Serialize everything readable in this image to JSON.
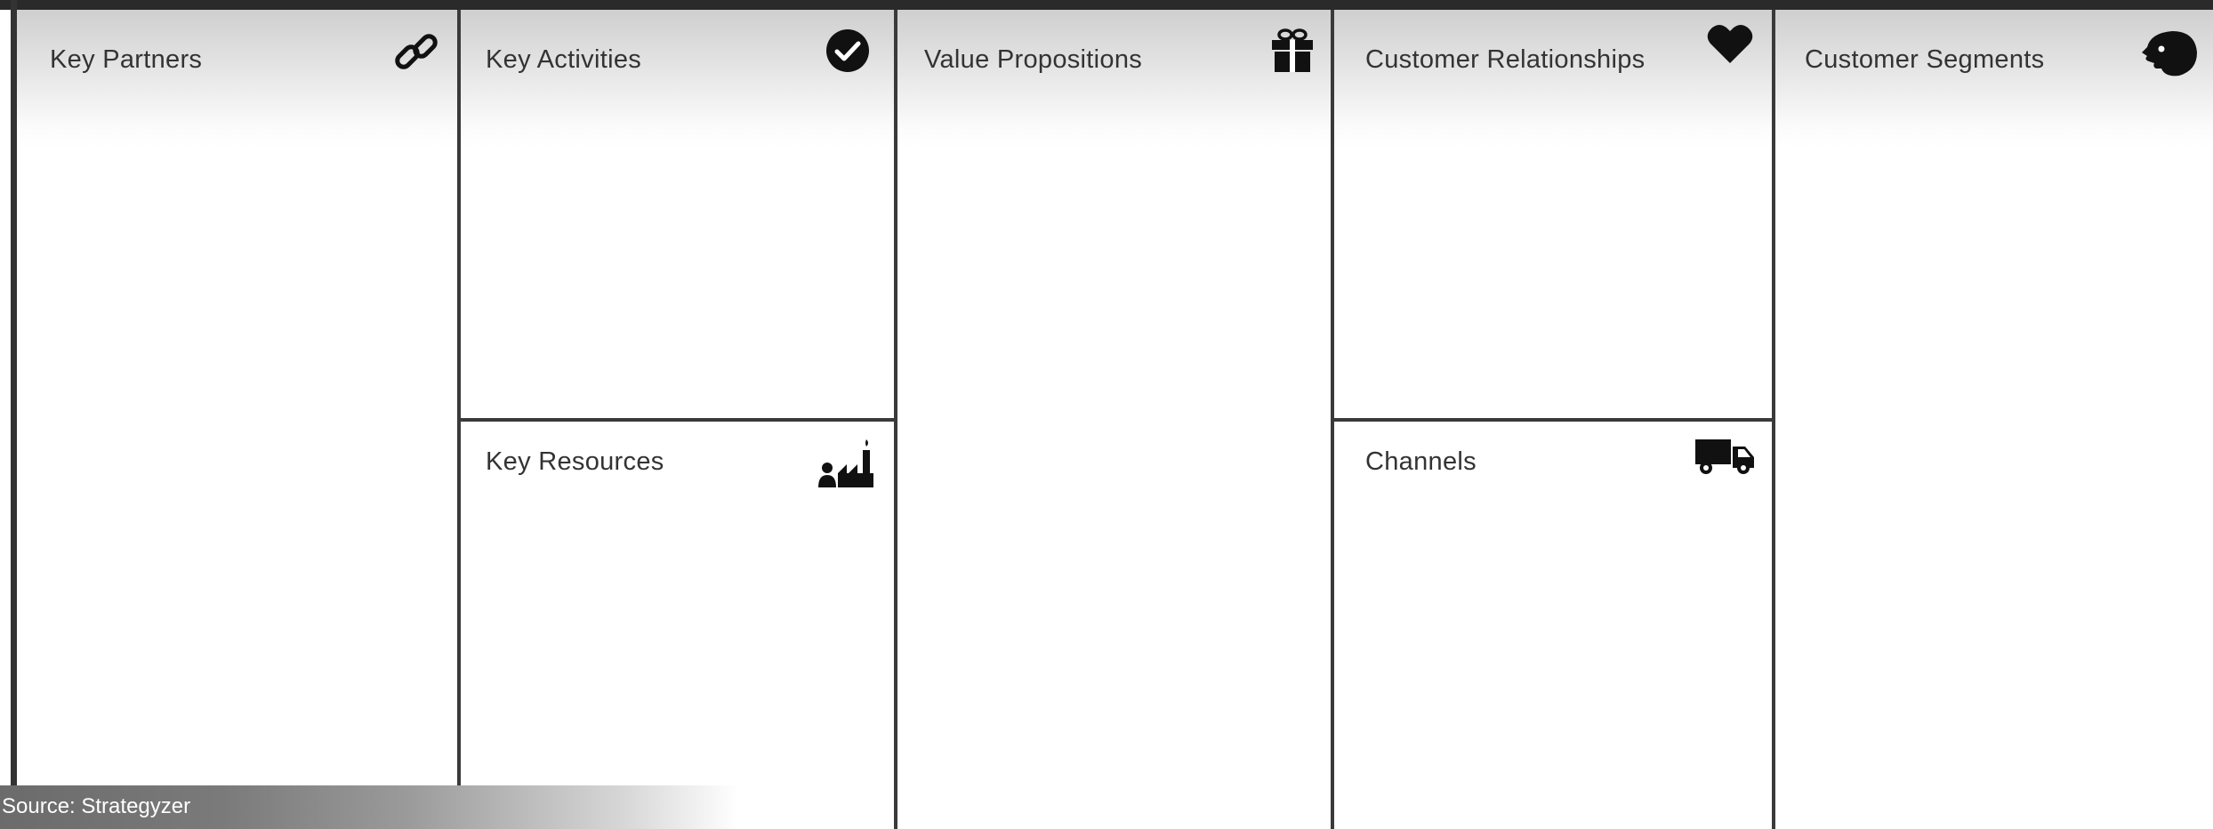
{
  "canvas": {
    "blocks": {
      "key_partners": {
        "title": "Key Partners",
        "icon": "link-icon"
      },
      "key_activities": {
        "title": "Key Activities",
        "icon": "check-circle-icon"
      },
      "key_resources": {
        "title": "Key Resources",
        "icon": "factory-worker-icon"
      },
      "value_propositions": {
        "title": "Value Propositions",
        "icon": "gift-icon"
      },
      "customer_relationships": {
        "title": "Customer Relationships",
        "icon": "heart-icon"
      },
      "channels": {
        "title": "Channels",
        "icon": "truck-icon"
      },
      "customer_segments": {
        "title": "Customer Segments",
        "icon": "head-icon"
      }
    }
  },
  "source_caption": "Source: Strategyzer",
  "colors": {
    "border": "#3a3a3a",
    "header_gradient_top": "#cfcfcf",
    "text": "#333333",
    "icon": "#111111"
  }
}
